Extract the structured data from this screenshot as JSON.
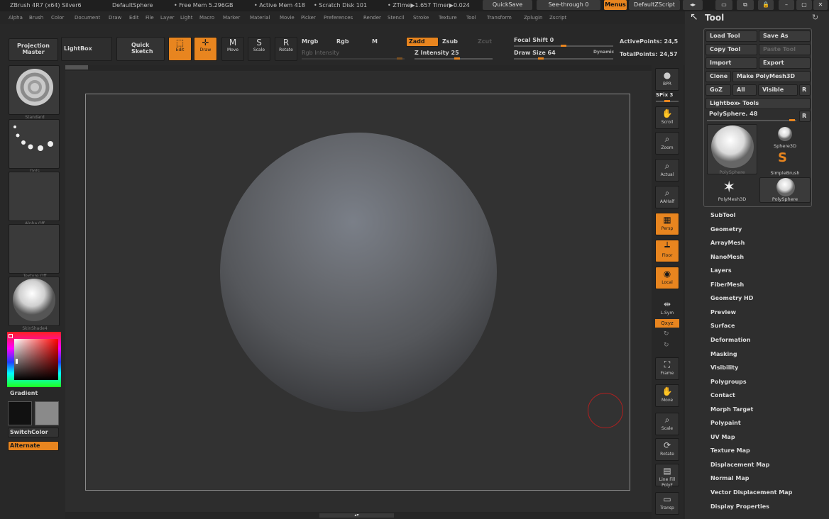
{
  "titlebar": {
    "app": "ZBrush 4R7 (x64) Silver6",
    "doc": "DefaultSphere",
    "free_mem": "• Free Mem 5.296GB",
    "active_mem": "• Active Mem 418",
    "scratch": "• Scratch Disk 101",
    "ztime": "• ZTime▶1.657 Timer▶0.024",
    "quicksave": "QuickSave",
    "see_through": "See-through  0",
    "menus": "Menus",
    "script": "DefaultZScript"
  },
  "menubar": [
    "Alpha",
    "Brush",
    "Color",
    "Document",
    "Draw",
    "Edit",
    "File",
    "Layer",
    "Light",
    "Macro",
    "Marker",
    "Material",
    "Movie",
    "Picker",
    "Preferences",
    "Render",
    "Stencil",
    "Stroke",
    "Texture",
    "Tool",
    "Transform",
    "Zplugin",
    "Zscript"
  ],
  "shelf": {
    "projection_master": "Projection Master",
    "lightbox": "LightBox",
    "quick_sketch": "Quick Sketch",
    "edit": "Edit",
    "draw": "Draw",
    "move": "Move",
    "scale": "Scale",
    "rotate": "Rotate",
    "mrgb": "Mrgb",
    "rgb": "Rgb",
    "m": "M",
    "rgb_intensity": "Rgb Intensity",
    "zadd": "Zadd",
    "zsub": "Zsub",
    "zcut": "Zcut",
    "z_intensity": "Z Intensity 25",
    "focal_shift": "Focal Shift 0",
    "draw_size": "Draw Size 64",
    "dynamic": "Dynamic",
    "active_points": "ActivePoints: 24,5",
    "total_points": "TotalPoints: 24,57"
  },
  "left": {
    "brush": "Standard",
    "stroke": "Dots",
    "alpha": "Alpha Off",
    "texture": "Texture Off",
    "material": "SkinShade4",
    "gradient": "Gradient",
    "switch_color": "SwitchColor",
    "alternate": "Alternate"
  },
  "right_strip": [
    "BPR",
    "SPix 3",
    "Scroll",
    "Zoom",
    "Actual",
    "AAHalf",
    "Persp",
    "Floor",
    "Local",
    "L.Sym",
    "Qxyz",
    "Frame",
    "Move",
    "Scale",
    "Rotate",
    "Line Fill PolyF",
    "Transp"
  ],
  "tool_panel": {
    "title": "Tool",
    "load_tool": "Load Tool",
    "save_as": "Save As",
    "copy_tool": "Copy Tool",
    "paste_tool": "Paste Tool",
    "import": "Import",
    "export": "Export",
    "clone": "Clone",
    "make_polymesh": "Make PolyMesh3D",
    "goz": "GoZ",
    "all": "All",
    "visible": "Visible",
    "r": "R",
    "lightbox_tools": "Lightbox▸ Tools",
    "current": "PolySphere. 48",
    "thumbs": [
      "PolySphere",
      "Sphere3D",
      "SimpleBrush",
      "PolyMesh3D",
      "PolySphere"
    ],
    "sections": [
      "SubTool",
      "Geometry",
      "ArrayMesh",
      "NanoMesh",
      "Layers",
      "FiberMesh",
      "Geometry HD",
      "Preview",
      "Surface",
      "Deformation",
      "Masking",
      "Visibility",
      "Polygroups",
      "Contact",
      "Morph Target",
      "Polypaint",
      "UV Map",
      "Texture Map",
      "Displacement Map",
      "Normal Map",
      "Vector Displacement Map",
      "Display Properties"
    ]
  },
  "colors": {
    "accent": "#e8851f",
    "primary_color": "#111111",
    "secondary_color": "#8a8a8a"
  }
}
